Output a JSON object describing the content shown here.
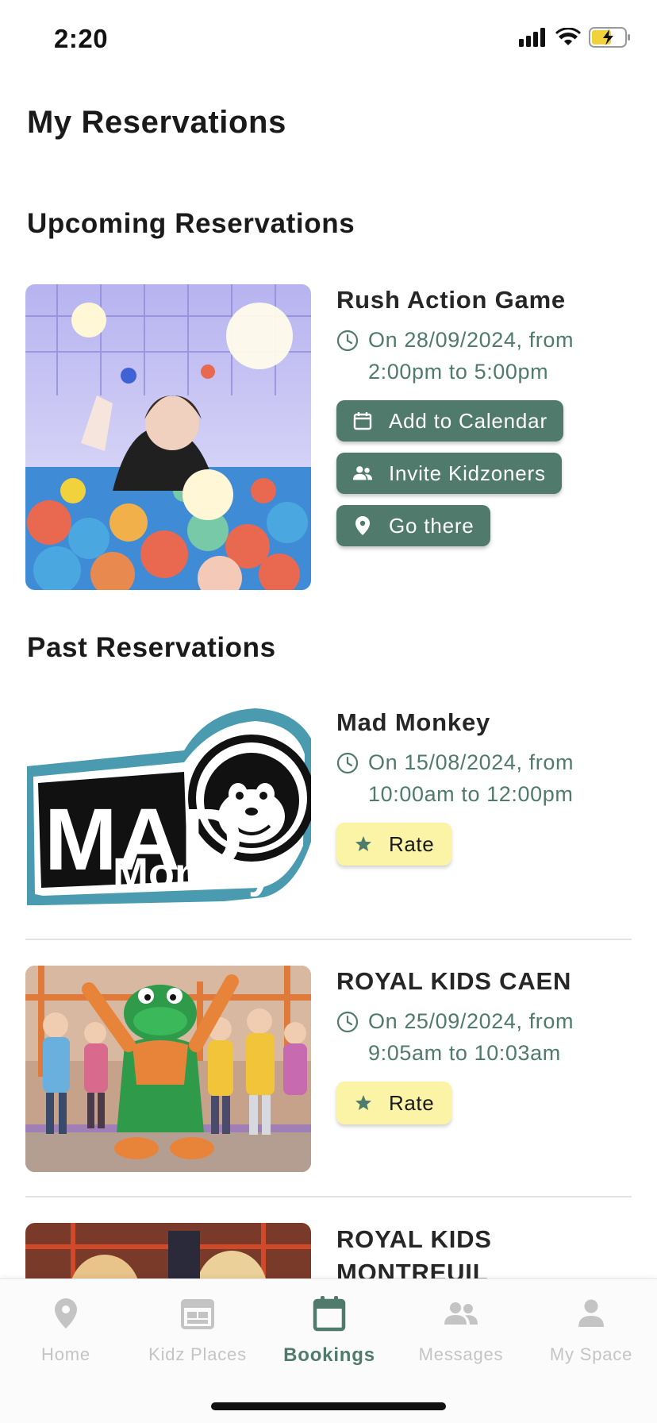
{
  "status_bar": {
    "time": "2:20"
  },
  "page_title": "My Reservations",
  "upcoming": {
    "title": "Upcoming Reservations",
    "items": [
      {
        "name": "Rush Action Game",
        "time_line1": "On 28/09/2024, from",
        "time_line2": "2:00pm to 5:00pm",
        "buttons": {
          "calendar": "Add to Calendar",
          "invite": "Invite Kidzoners",
          "go": "Go there"
        }
      }
    ]
  },
  "past": {
    "title": "Past Reservations",
    "items": [
      {
        "name": "Mad Monkey",
        "time_line1": "On 15/08/2024, from",
        "time_line2": "10:00am to 12:00pm",
        "rate": "Rate",
        "logo_text_1": "MAD",
        "logo_text_2": "Monkey"
      },
      {
        "name": "ROYAL KIDS CAEN",
        "time_line1": "On 25/09/2024, from",
        "time_line2": "9:05am to 10:03am",
        "rate": "Rate"
      },
      {
        "name": "ROYAL KIDS MONTREUIL"
      }
    ]
  },
  "tabs": [
    {
      "label": "Home",
      "icon": "map-pin-icon",
      "active": false
    },
    {
      "label": "Kidz Places",
      "icon": "places-icon",
      "active": false
    },
    {
      "label": "Bookings",
      "icon": "calendar-icon",
      "active": true
    },
    {
      "label": "Messages",
      "icon": "people-icon",
      "active": false
    },
    {
      "label": "My Space",
      "icon": "person-icon",
      "active": false
    }
  ],
  "colors": {
    "accent": "#4f7a6c",
    "rate_bg": "#fbf3a6",
    "tab_inactive": "#c4c4c4"
  }
}
